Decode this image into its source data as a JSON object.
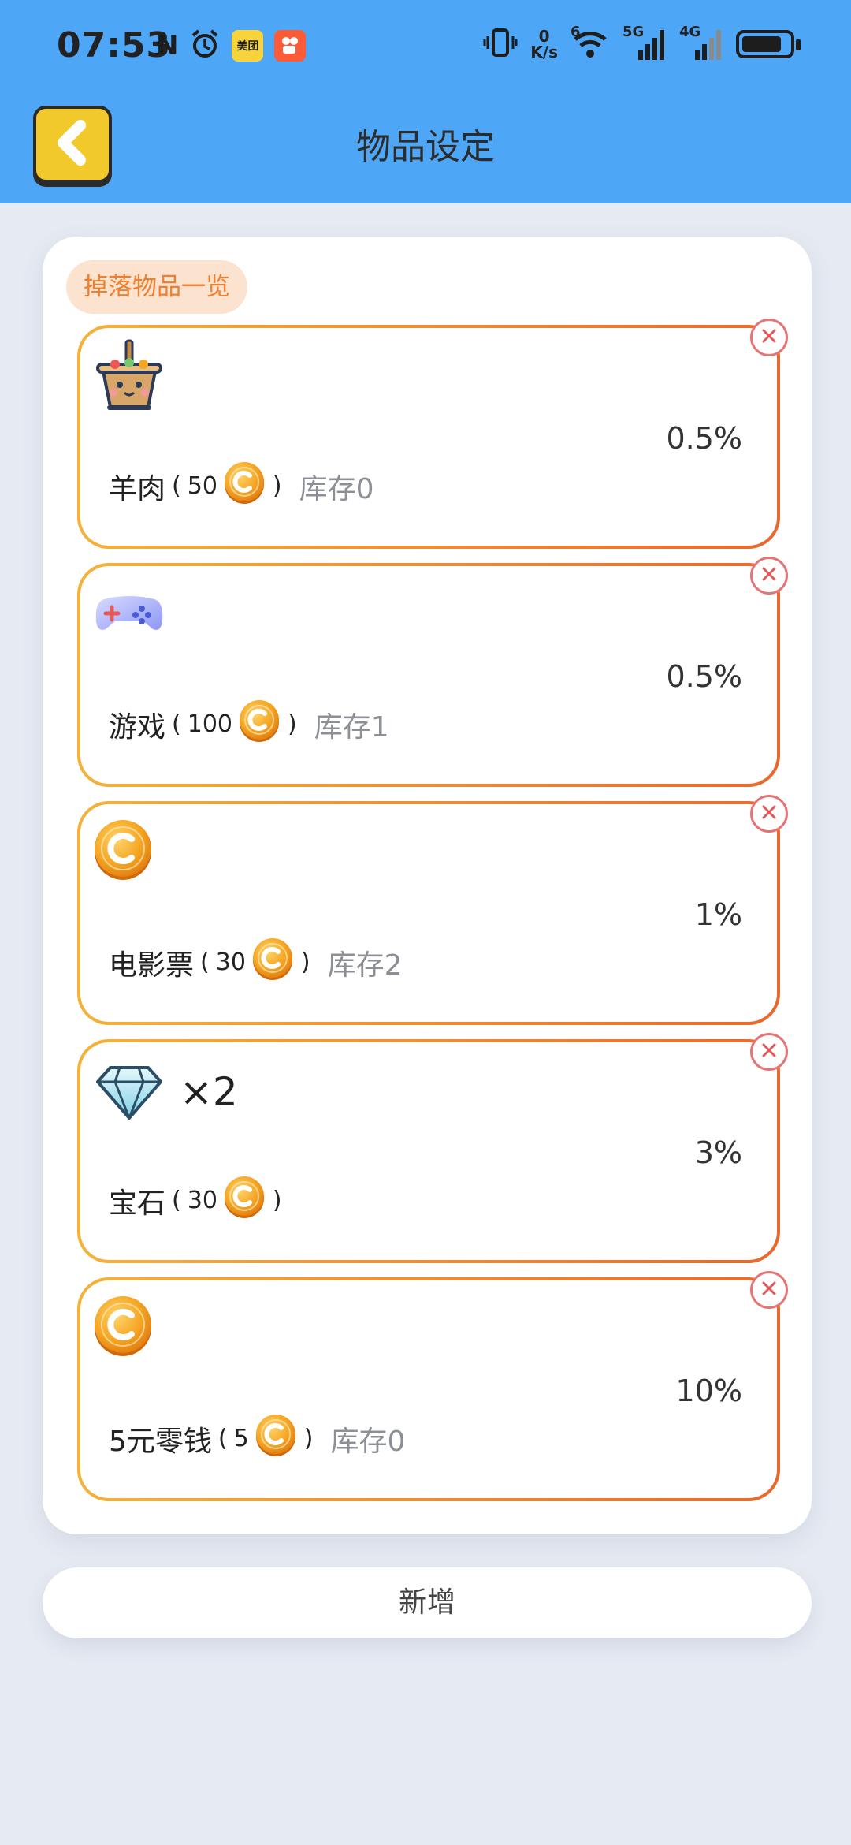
{
  "status_bar": {
    "time": "07:53",
    "left_icons": [
      "nfc-icon",
      "alarm-icon",
      "meituan-app-icon",
      "kuaishou-app-icon"
    ],
    "meituan_label": "美团",
    "nfc_glyph": "N",
    "speed_value": "0",
    "speed_unit": "K/s",
    "wifi_sup": "6",
    "net1": "5G",
    "net2": "4G",
    "battery_level": 0.85
  },
  "header": {
    "title": "物品设定",
    "back_icon": "chevron-left-icon"
  },
  "section": {
    "label": "掉落物品一览"
  },
  "items": [
    {
      "name": "羊肉",
      "price": "50",
      "stock": "库存0",
      "rate": "0.5%",
      "icon": "hotpot-icon",
      "quantity": ""
    },
    {
      "name": "游戏",
      "price": "100",
      "stock": "库存1",
      "rate": "0.5%",
      "icon": "gamepad-icon",
      "quantity": ""
    },
    {
      "name": "电影票",
      "price": "30",
      "stock": "库存2",
      "rate": "1%",
      "icon": "coin-icon",
      "quantity": ""
    },
    {
      "name": "宝石",
      "price": "30",
      "stock": "",
      "rate": "3%",
      "icon": "diamond-icon",
      "quantity": "×2"
    },
    {
      "name": "5元零钱",
      "price": "5",
      "stock": "库存0",
      "rate": "10%",
      "icon": "coin-icon",
      "quantity": ""
    }
  ],
  "punctuation": {
    "open": "(",
    "close": ")"
  },
  "add_button": {
    "label": "新增"
  },
  "colors": {
    "header_bg": "#4ea6f7",
    "accent_orange": "#f0802f",
    "card_border_start": "#f2b33b",
    "card_border_end": "#e9682d",
    "back_button": "#f2c92b",
    "delete": "#e57575"
  }
}
